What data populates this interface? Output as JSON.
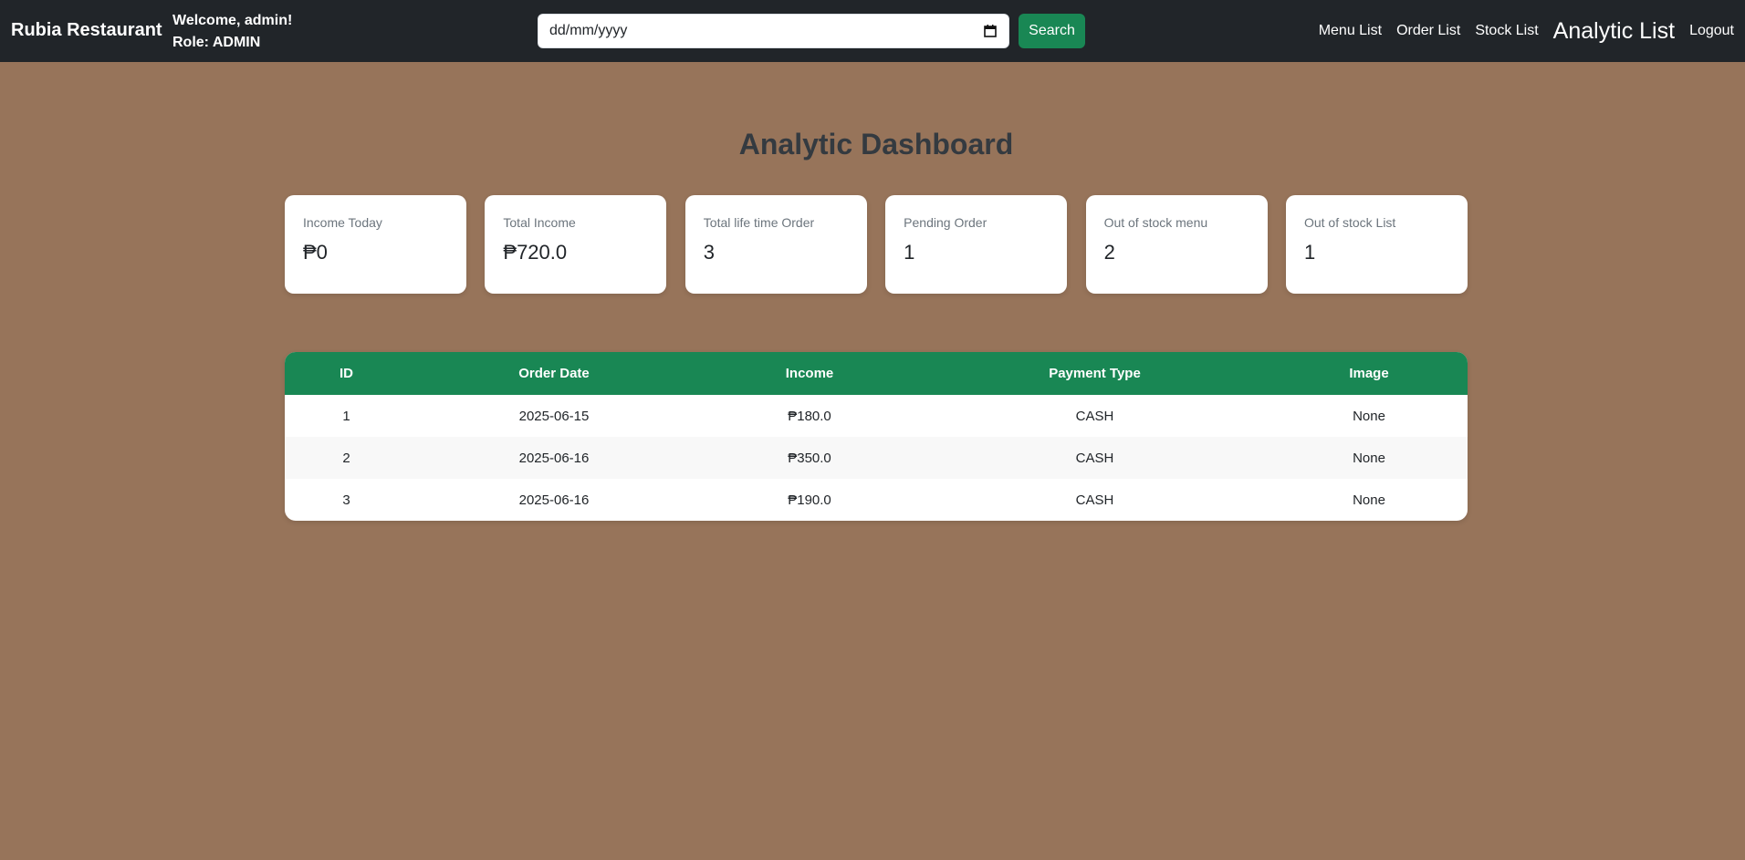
{
  "navbar": {
    "brand": "Rubia Restaurant",
    "welcome": "Welcome, admin!",
    "role": "Role: ADMIN",
    "date_placeholder": "dd/mm/yyyy",
    "search_label": "Search",
    "links": [
      {
        "label": "Menu List"
      },
      {
        "label": "Order List"
      },
      {
        "label": "Stock List"
      },
      {
        "label": "Analytic List",
        "active": true
      },
      {
        "label": "Logout"
      }
    ]
  },
  "main": {
    "title": "Analytic Dashboard",
    "cards": [
      {
        "label": "Income Today",
        "value": "₱0"
      },
      {
        "label": "Total Income",
        "value": "₱720.0"
      },
      {
        "label": "Total life time Order",
        "value": "3"
      },
      {
        "label": "Pending Order",
        "value": "1"
      },
      {
        "label": "Out of stock menu",
        "value": "2"
      },
      {
        "label": "Out of stock List",
        "value": "1"
      }
    ],
    "table": {
      "headers": [
        "ID",
        "Order Date",
        "Income",
        "Payment Type",
        "Image"
      ],
      "rows": [
        [
          "1",
          "2025-06-15",
          "₱180.0",
          "CASH",
          "None"
        ],
        [
          "2",
          "2025-06-16",
          "₱350.0",
          "CASH",
          "None"
        ],
        [
          "3",
          "2025-06-16",
          "₱190.0",
          "CASH",
          "None"
        ]
      ]
    }
  },
  "colors": {
    "background": "#97745a",
    "navbar": "#212529",
    "accent": "#198754"
  },
  "icons": {
    "date_picker": "calendar-icon"
  }
}
